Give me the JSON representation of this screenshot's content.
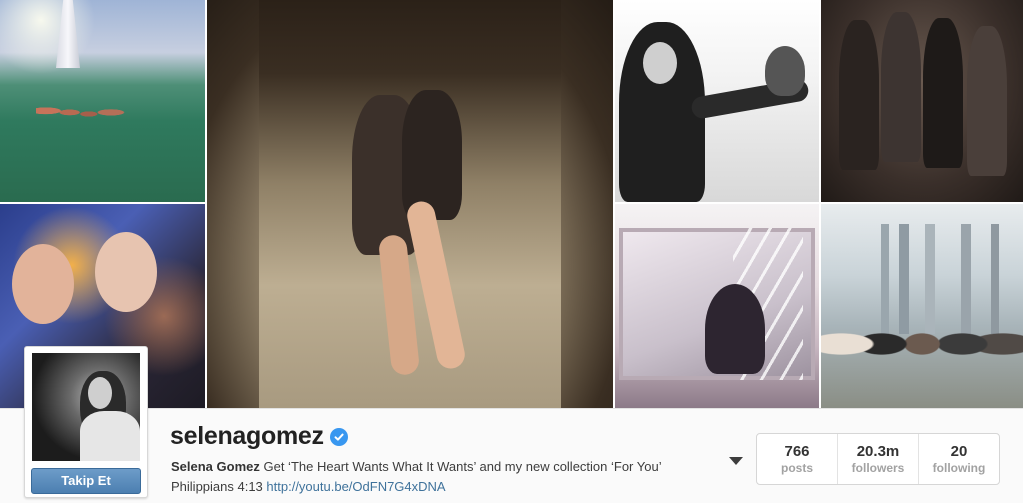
{
  "photos": [
    {
      "id": "beach-sea-photo",
      "alt": "Friends swimming in the sea"
    },
    {
      "id": "selfie-photo",
      "alt": "Two women selfie"
    },
    {
      "id": "night-beach-photo",
      "alt": "Two women sitting on sand at night"
    },
    {
      "id": "falcon-photo",
      "alt": "Woman with falcon"
    },
    {
      "id": "group-night-photo",
      "alt": "Group at night"
    },
    {
      "id": "window-photo",
      "alt": "Person sitting by window"
    },
    {
      "id": "skyline-group-photo",
      "alt": "Group in front of skyline"
    }
  ],
  "profile": {
    "username": "selenagomez",
    "verified": true,
    "full_name": "Selena Gomez",
    "bio_text": " Get ‘The Heart Wants What It Wants’ and my new collection ‘For You’",
    "bio_line2": "Philippians 4:13 ",
    "link": "http://youtu.be/OdFN7G4xDNA",
    "follow_button_label": "Takip Et"
  },
  "stats": [
    {
      "value": "766",
      "label": "posts"
    },
    {
      "value": "20.3m",
      "label": "followers"
    },
    {
      "value": "20",
      "label": "following"
    }
  ],
  "colors": {
    "follow_button": "#4c7fb1",
    "verified_badge": "#3897f0",
    "link": "#3f729b"
  }
}
